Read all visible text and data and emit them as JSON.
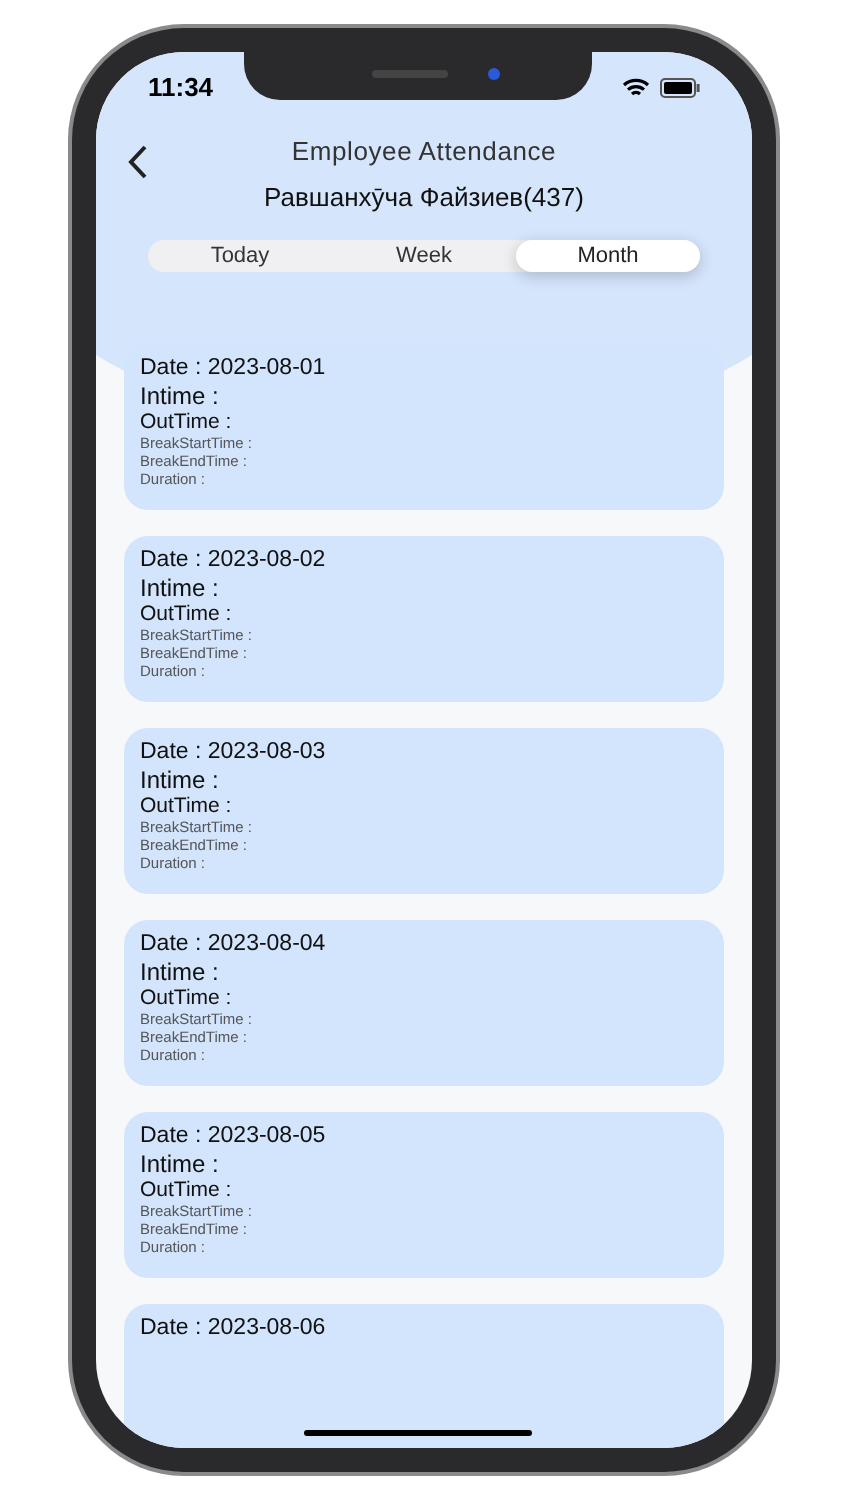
{
  "status_bar": {
    "time": "11:34"
  },
  "header": {
    "title": "Employee Attendance",
    "employee": "Равшанхӯча Файзиев(437)"
  },
  "tabs": [
    {
      "label": "Today",
      "selected": false
    },
    {
      "label": "Week",
      "selected": false
    },
    {
      "label": "Month",
      "selected": true
    }
  ],
  "records": [
    {
      "date": "Date : 2023-08-01",
      "intime": "Intime :",
      "outtime": "OutTime :",
      "break_start": "BreakStartTime :",
      "break_end": "BreakEndTime :",
      "duration": "Duration :"
    },
    {
      "date": "Date : 2023-08-02",
      "intime": "Intime :",
      "outtime": "OutTime :",
      "break_start": "BreakStartTime :",
      "break_end": "BreakEndTime :",
      "duration": "Duration :"
    },
    {
      "date": "Date : 2023-08-03",
      "intime": "Intime :",
      "outtime": "OutTime :",
      "break_start": "BreakStartTime :",
      "break_end": "BreakEndTime :",
      "duration": "Duration :"
    },
    {
      "date": "Date : 2023-08-04",
      "intime": "Intime :",
      "outtime": "OutTime :",
      "break_start": "BreakStartTime :",
      "break_end": "BreakEndTime :",
      "duration": "Duration :"
    },
    {
      "date": "Date : 2023-08-05",
      "intime": "Intime :",
      "outtime": "OutTime :",
      "break_start": "BreakStartTime :",
      "break_end": "BreakEndTime :",
      "duration": "Duration :"
    },
    {
      "date": "Date : 2023-08-06"
    }
  ]
}
